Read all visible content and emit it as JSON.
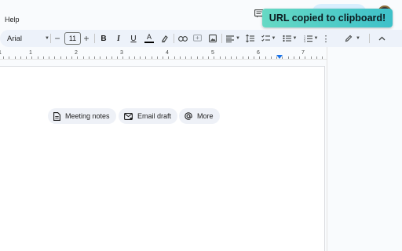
{
  "menu": {
    "help_label": "Help"
  },
  "toast": {
    "message": "URL copied to clipboard!"
  },
  "toolbar": {
    "font_name": "Arial",
    "font_size": "11",
    "decrease_label": "−",
    "increase_label": "+",
    "bold_label": "B",
    "italic_label": "I",
    "underline_label": "U",
    "text_color_label": "A"
  },
  "ruler": {
    "numbers": [
      "1",
      "1",
      "2",
      "3",
      "4",
      "5",
      "6",
      "7"
    ]
  },
  "chips": [
    {
      "label": "Meeting notes",
      "icon": "document-icon"
    },
    {
      "label": "Email draft",
      "icon": "email-icon"
    },
    {
      "label": "More",
      "icon": "at-sign-icon"
    }
  ],
  "colors": {
    "toast_start": "#66d9c4",
    "toast_end": "#3ec1c9",
    "accent": "#1a73e8"
  }
}
